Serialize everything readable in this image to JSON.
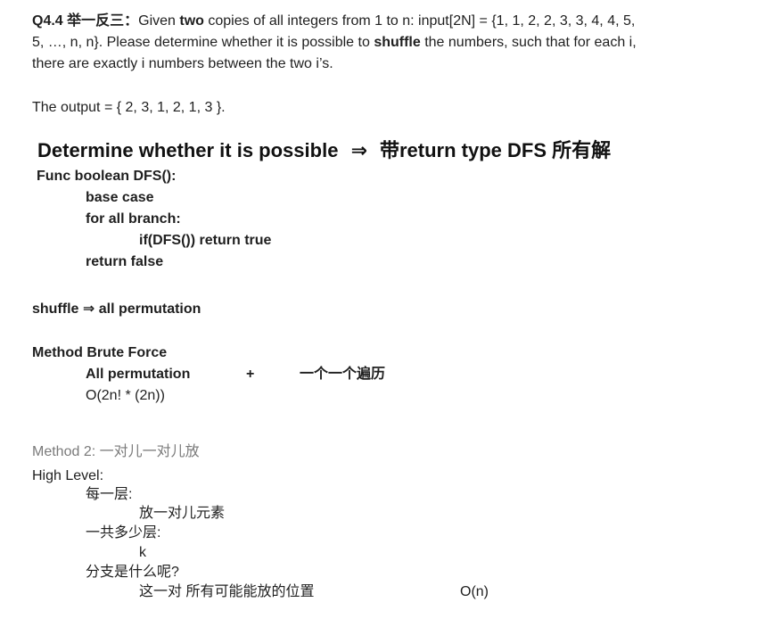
{
  "question": {
    "p1": "Q4.4 举一反三：",
    "p2": "Given ",
    "p3": "two",
    "p4": " copies of all integers from 1 to n: input[2N] = {1, 1, 2, 2, 3, 3, 4, 4, 5,",
    "line2": "5, …, n, n}. Please determine whether it is possible to ",
    "line2_bold": "shuffle",
    "line2_end": " the numbers, such that for each i,",
    "line3": "there are exactly i numbers between the two i’s."
  },
  "output_line": "The output = { 2, 3, 1, 2, 1, 3 }.",
  "heading": {
    "left": "Determine whether it is possible",
    "arrow": "⇒",
    "right": "带return type DFS  所有解"
  },
  "pseudo": {
    "func": "Func boolean DFS():",
    "base": "base case",
    "forall": "for all branch:",
    "ifdfs": "if(DFS()) return true",
    "retfalse": "return false"
  },
  "shuffle_line": "shuffle ⇒ all permutation",
  "method1": {
    "title": "Method Brute Force",
    "allperm": "All permutation",
    "plus": "+",
    "traverse": "一个一个遍历",
    "complexity": "O(2n! * (2n))"
  },
  "method2": {
    "title": "Method 2: 一对儿一对儿放",
    "high_level": "High Level:",
    "each_layer": "每一层:",
    "place_pair": "放一对儿元素",
    "total_layers": "一共多少层:",
    "k": "k",
    "branches": "分支是什么呢?",
    "positions": "这一对 所有可能能放的位置",
    "on": "O(n)"
  }
}
